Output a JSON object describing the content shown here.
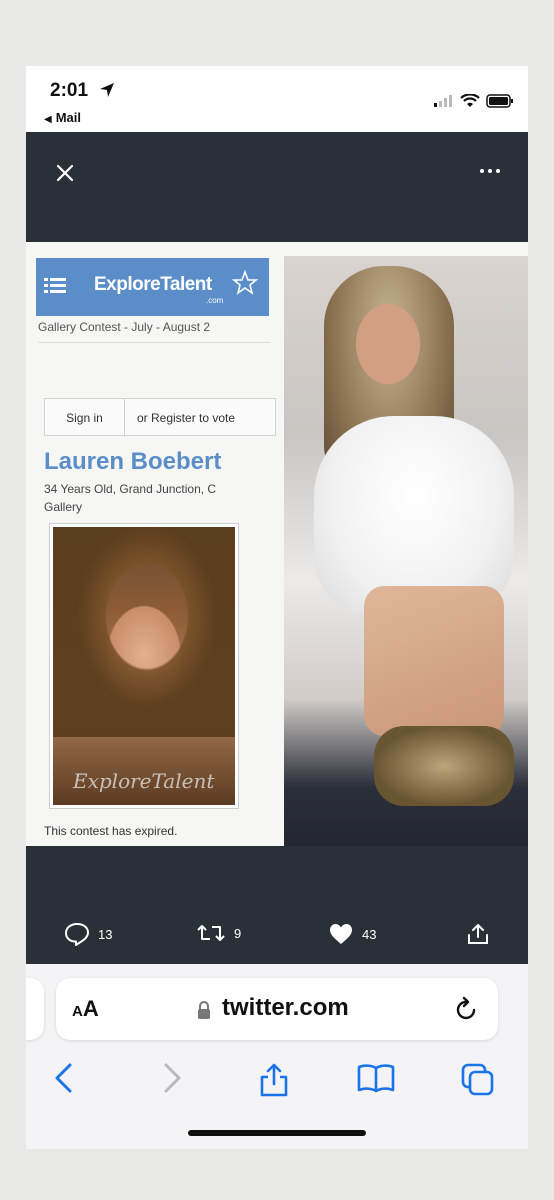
{
  "status_bar": {
    "time": "2:01",
    "back_app": "Mail"
  },
  "media": {
    "site_logo": "ExploreTalent",
    "site_logo_sub": ".com",
    "contest_line": "Gallery Contest - July - August 2",
    "signin_label": "Sign in",
    "register_label": "or Register to vote",
    "profile_name": "Lauren Boebert",
    "profile_meta": "34 Years Old, Grand Junction, C",
    "profile_gallery": "Gallery",
    "watermark": "ExploreTalent",
    "expired_text": "This contest has expired."
  },
  "actions": {
    "replies": "13",
    "retweets": "9",
    "likes": "43"
  },
  "safari": {
    "aa_label_small": "A",
    "aa_label_large": "A",
    "url": "twitter.com"
  },
  "colors": {
    "viewer_bg": "#2a3038",
    "explore_blue": "#5b8ec9",
    "safari_blue": "#1a73e8"
  }
}
